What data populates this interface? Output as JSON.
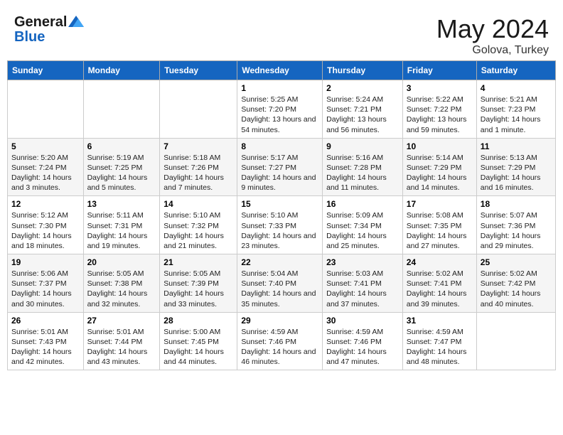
{
  "header": {
    "logo_line1": "General",
    "logo_line2": "Blue",
    "title": "May 2024",
    "subtitle": "Golova, Turkey"
  },
  "days_of_week": [
    "Sunday",
    "Monday",
    "Tuesday",
    "Wednesday",
    "Thursday",
    "Friday",
    "Saturday"
  ],
  "weeks": [
    [
      {
        "day": "",
        "sunrise": "",
        "sunset": "",
        "daylight": ""
      },
      {
        "day": "",
        "sunrise": "",
        "sunset": "",
        "daylight": ""
      },
      {
        "day": "",
        "sunrise": "",
        "sunset": "",
        "daylight": ""
      },
      {
        "day": "1",
        "sunrise": "Sunrise: 5:25 AM",
        "sunset": "Sunset: 7:20 PM",
        "daylight": "Daylight: 13 hours and 54 minutes."
      },
      {
        "day": "2",
        "sunrise": "Sunrise: 5:24 AM",
        "sunset": "Sunset: 7:21 PM",
        "daylight": "Daylight: 13 hours and 56 minutes."
      },
      {
        "day": "3",
        "sunrise": "Sunrise: 5:22 AM",
        "sunset": "Sunset: 7:22 PM",
        "daylight": "Daylight: 13 hours and 59 minutes."
      },
      {
        "day": "4",
        "sunrise": "Sunrise: 5:21 AM",
        "sunset": "Sunset: 7:23 PM",
        "daylight": "Daylight: 14 hours and 1 minute."
      }
    ],
    [
      {
        "day": "5",
        "sunrise": "Sunrise: 5:20 AM",
        "sunset": "Sunset: 7:24 PM",
        "daylight": "Daylight: 14 hours and 3 minutes."
      },
      {
        "day": "6",
        "sunrise": "Sunrise: 5:19 AM",
        "sunset": "Sunset: 7:25 PM",
        "daylight": "Daylight: 14 hours and 5 minutes."
      },
      {
        "day": "7",
        "sunrise": "Sunrise: 5:18 AM",
        "sunset": "Sunset: 7:26 PM",
        "daylight": "Daylight: 14 hours and 7 minutes."
      },
      {
        "day": "8",
        "sunrise": "Sunrise: 5:17 AM",
        "sunset": "Sunset: 7:27 PM",
        "daylight": "Daylight: 14 hours and 9 minutes."
      },
      {
        "day": "9",
        "sunrise": "Sunrise: 5:16 AM",
        "sunset": "Sunset: 7:28 PM",
        "daylight": "Daylight: 14 hours and 11 minutes."
      },
      {
        "day": "10",
        "sunrise": "Sunrise: 5:14 AM",
        "sunset": "Sunset: 7:29 PM",
        "daylight": "Daylight: 14 hours and 14 minutes."
      },
      {
        "day": "11",
        "sunrise": "Sunrise: 5:13 AM",
        "sunset": "Sunset: 7:29 PM",
        "daylight": "Daylight: 14 hours and 16 minutes."
      }
    ],
    [
      {
        "day": "12",
        "sunrise": "Sunrise: 5:12 AM",
        "sunset": "Sunset: 7:30 PM",
        "daylight": "Daylight: 14 hours and 18 minutes."
      },
      {
        "day": "13",
        "sunrise": "Sunrise: 5:11 AM",
        "sunset": "Sunset: 7:31 PM",
        "daylight": "Daylight: 14 hours and 19 minutes."
      },
      {
        "day": "14",
        "sunrise": "Sunrise: 5:10 AM",
        "sunset": "Sunset: 7:32 PM",
        "daylight": "Daylight: 14 hours and 21 minutes."
      },
      {
        "day": "15",
        "sunrise": "Sunrise: 5:10 AM",
        "sunset": "Sunset: 7:33 PM",
        "daylight": "Daylight: 14 hours and 23 minutes."
      },
      {
        "day": "16",
        "sunrise": "Sunrise: 5:09 AM",
        "sunset": "Sunset: 7:34 PM",
        "daylight": "Daylight: 14 hours and 25 minutes."
      },
      {
        "day": "17",
        "sunrise": "Sunrise: 5:08 AM",
        "sunset": "Sunset: 7:35 PM",
        "daylight": "Daylight: 14 hours and 27 minutes."
      },
      {
        "day": "18",
        "sunrise": "Sunrise: 5:07 AM",
        "sunset": "Sunset: 7:36 PM",
        "daylight": "Daylight: 14 hours and 29 minutes."
      }
    ],
    [
      {
        "day": "19",
        "sunrise": "Sunrise: 5:06 AM",
        "sunset": "Sunset: 7:37 PM",
        "daylight": "Daylight: 14 hours and 30 minutes."
      },
      {
        "day": "20",
        "sunrise": "Sunrise: 5:05 AM",
        "sunset": "Sunset: 7:38 PM",
        "daylight": "Daylight: 14 hours and 32 minutes."
      },
      {
        "day": "21",
        "sunrise": "Sunrise: 5:05 AM",
        "sunset": "Sunset: 7:39 PM",
        "daylight": "Daylight: 14 hours and 33 minutes."
      },
      {
        "day": "22",
        "sunrise": "Sunrise: 5:04 AM",
        "sunset": "Sunset: 7:40 PM",
        "daylight": "Daylight: 14 hours and 35 minutes."
      },
      {
        "day": "23",
        "sunrise": "Sunrise: 5:03 AM",
        "sunset": "Sunset: 7:41 PM",
        "daylight": "Daylight: 14 hours and 37 minutes."
      },
      {
        "day": "24",
        "sunrise": "Sunrise: 5:02 AM",
        "sunset": "Sunset: 7:41 PM",
        "daylight": "Daylight: 14 hours and 39 minutes."
      },
      {
        "day": "25",
        "sunrise": "Sunrise: 5:02 AM",
        "sunset": "Sunset: 7:42 PM",
        "daylight": "Daylight: 14 hours and 40 minutes."
      }
    ],
    [
      {
        "day": "26",
        "sunrise": "Sunrise: 5:01 AM",
        "sunset": "Sunset: 7:43 PM",
        "daylight": "Daylight: 14 hours and 42 minutes."
      },
      {
        "day": "27",
        "sunrise": "Sunrise: 5:01 AM",
        "sunset": "Sunset: 7:44 PM",
        "daylight": "Daylight: 14 hours and 43 minutes."
      },
      {
        "day": "28",
        "sunrise": "Sunrise: 5:00 AM",
        "sunset": "Sunset: 7:45 PM",
        "daylight": "Daylight: 14 hours and 44 minutes."
      },
      {
        "day": "29",
        "sunrise": "Sunrise: 4:59 AM",
        "sunset": "Sunset: 7:46 PM",
        "daylight": "Daylight: 14 hours and 46 minutes."
      },
      {
        "day": "30",
        "sunrise": "Sunrise: 4:59 AM",
        "sunset": "Sunset: 7:46 PM",
        "daylight": "Daylight: 14 hours and 47 minutes."
      },
      {
        "day": "31",
        "sunrise": "Sunrise: 4:59 AM",
        "sunset": "Sunset: 7:47 PM",
        "daylight": "Daylight: 14 hours and 48 minutes."
      },
      {
        "day": "",
        "sunrise": "",
        "sunset": "",
        "daylight": ""
      }
    ]
  ]
}
